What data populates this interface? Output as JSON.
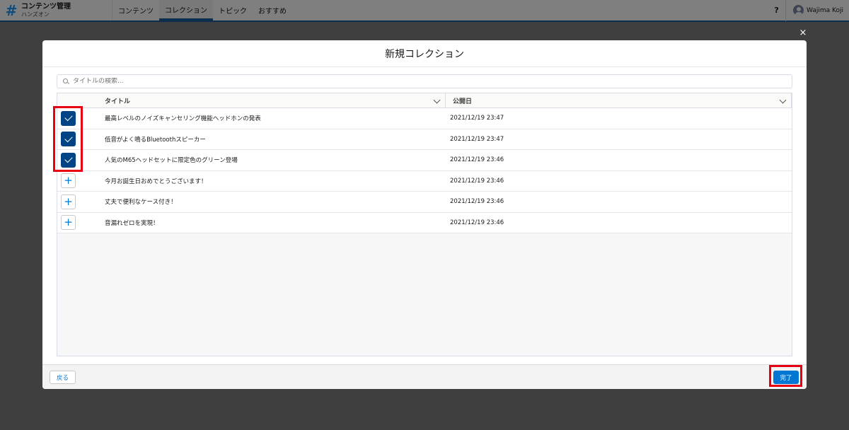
{
  "header": {
    "logo_glyph": "#",
    "app_title": "コンテンツ管理",
    "app_subtitle": "ハンズオン",
    "nav": [
      {
        "label": "コンテンツ"
      },
      {
        "label": "コレクション"
      },
      {
        "label": "トピック"
      },
      {
        "label": "おすすめ"
      }
    ],
    "active_nav": "コレクション",
    "help_label": "?",
    "user_name": "Wajima Koji"
  },
  "modal": {
    "close_glyph": "×",
    "title": "新規コレクション",
    "search_placeholder": "タイトルの検索...",
    "columns": {
      "title": "タイトル",
      "date": "公開日"
    },
    "rows": [
      {
        "title": "最高レベルのノイズキャンセリング機能ヘッドホンの発表",
        "date": "2021/12/19 23:47",
        "selected": true
      },
      {
        "title": "低音がよく鳴るBluetoothスピーカー",
        "date": "2021/12/19 23:47",
        "selected": true
      },
      {
        "title": "人気のM65ヘッドセットに限定色のグリーン登場",
        "date": "2021/12/19 23:46",
        "selected": true
      },
      {
        "title": "今月お誕生日おめでとうございます！",
        "date": "2021/12/19 23:46",
        "selected": false
      },
      {
        "title": "丈夫で便利なケース付き！",
        "date": "2021/12/19 23:46",
        "selected": false
      },
      {
        "title": "音漏れゼロを実現！",
        "date": "2021/12/19 23:46",
        "selected": false
      }
    ],
    "add_glyph": "+",
    "back_label": "戻る",
    "done_label": "完了"
  },
  "colors": {
    "brand_blue": "#0176d3",
    "checked_blue": "#014486",
    "highlight_red": "#e60012"
  }
}
